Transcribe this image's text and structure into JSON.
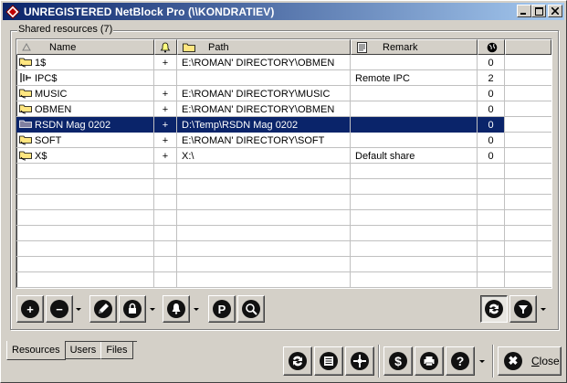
{
  "window": {
    "title": "UNREGISTERED NetBlock Pro (\\\\KONDRATIEV)",
    "buttons": {
      "minimize": "_",
      "maximize": "□",
      "close": "×"
    }
  },
  "group": {
    "label": "Shared resources (7)"
  },
  "table": {
    "columns": {
      "name": "Name",
      "path": "Path",
      "remark": "Remark"
    },
    "rows": [
      {
        "icon": "shared-folder-icon",
        "name": "1$",
        "flag": "+",
        "path": "E:\\ROMAN' DIRECTORY\\OBMEN",
        "remark": "",
        "connections": "0"
      },
      {
        "icon": "ipc-icon",
        "name": "IPC$",
        "flag": "",
        "path": "",
        "remark": "Remote IPC",
        "connections": "2"
      },
      {
        "icon": "shared-folder-icon",
        "name": "MUSIC",
        "flag": "+",
        "path": "E:\\ROMAN' DIRECTORY\\MUSIC",
        "remark": "",
        "connections": "0"
      },
      {
        "icon": "shared-folder-icon",
        "name": "OBMEN",
        "flag": "+",
        "path": "E:\\ROMAN' DIRECTORY\\OBMEN",
        "remark": "",
        "connections": "0"
      },
      {
        "icon": "shared-folder-icon",
        "name": "RSDN Mag 0202",
        "flag": "+",
        "path": "D:\\Temp\\RSDN Mag 0202",
        "remark": "",
        "connections": "0",
        "selected": true
      },
      {
        "icon": "shared-folder-icon",
        "name": "SOFT",
        "flag": "+",
        "path": "E:\\ROMAN' DIRECTORY\\SOFT",
        "remark": "",
        "connections": "0"
      },
      {
        "icon": "shared-folder-icon",
        "name": "X$",
        "flag": "+",
        "path": "X:\\",
        "remark": "Default share",
        "connections": "0"
      }
    ]
  },
  "toolbar": {
    "add_icon": "+",
    "remove_icon": "−",
    "properties_icon": "P"
  },
  "tabs": [
    "Resources",
    "Users",
    "Files"
  ],
  "bottom": {
    "close_label": "Close",
    "close_icon": "✖"
  },
  "colors": {
    "selection": "#0a246a",
    "titlebar": "#0a246a",
    "face": "#d4d0c8"
  }
}
